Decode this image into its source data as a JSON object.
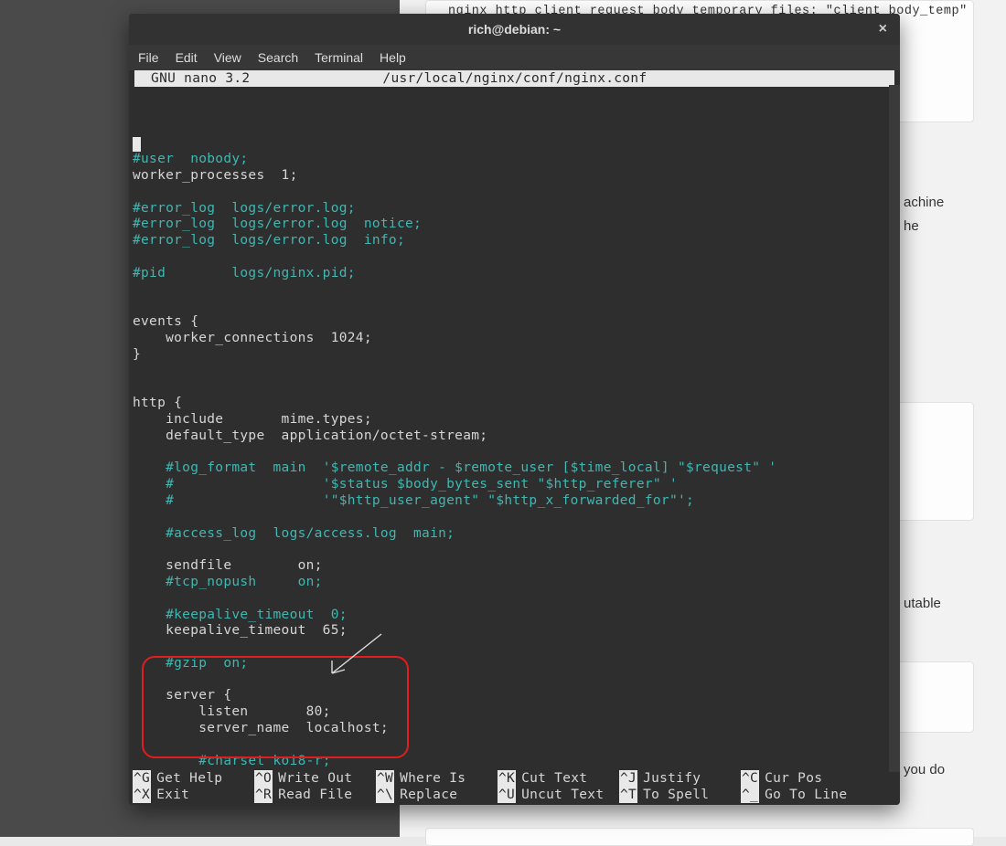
{
  "background": {
    "code_snippet": "nginx http client request body temporary files: \"client_body_temp\"",
    "para1_a": "achine",
    "para1_b": "he",
    "para2": "utable",
    "para3": "you do"
  },
  "terminal": {
    "title": "rich@debian: ~",
    "menu": [
      "File",
      "Edit",
      "View",
      "Search",
      "Terminal",
      "Help"
    ],
    "nano_header_left": "  GNU nano 3.2",
    "nano_header_right": "/usr/local/nginx/conf/nginx.conf",
    "lines": [
      {
        "t": "",
        "c": "plain",
        "cursor": true
      },
      {
        "t": "#user  nobody;",
        "c": "comment"
      },
      {
        "t": "worker_processes  1;",
        "c": "plain"
      },
      {
        "t": "",
        "c": "plain"
      },
      {
        "t": "#error_log  logs/error.log;",
        "c": "comment"
      },
      {
        "t": "#error_log  logs/error.log  notice;",
        "c": "comment"
      },
      {
        "t": "#error_log  logs/error.log  info;",
        "c": "comment"
      },
      {
        "t": "",
        "c": "plain"
      },
      {
        "t": "#pid        logs/nginx.pid;",
        "c": "comment"
      },
      {
        "t": "",
        "c": "plain"
      },
      {
        "t": "",
        "c": "plain"
      },
      {
        "t": "events {",
        "c": "plain"
      },
      {
        "t": "    worker_connections  1024;",
        "c": "plain"
      },
      {
        "t": "}",
        "c": "plain"
      },
      {
        "t": "",
        "c": "plain"
      },
      {
        "t": "",
        "c": "plain"
      },
      {
        "t": "http {",
        "c": "plain"
      },
      {
        "t": "    include       mime.types;",
        "c": "plain"
      },
      {
        "t": "    default_type  application/octet-stream;",
        "c": "plain"
      },
      {
        "t": "",
        "c": "plain"
      },
      {
        "t": "    #log_format  main  '$remote_addr - $remote_user [$time_local] \"$request\" '",
        "c": "comment"
      },
      {
        "t": "    #                  '$status $body_bytes_sent \"$http_referer\" '",
        "c": "comment"
      },
      {
        "t": "    #                  '\"$http_user_agent\" \"$http_x_forwarded_for\"';",
        "c": "comment"
      },
      {
        "t": "",
        "c": "plain"
      },
      {
        "t": "    #access_log  logs/access.log  main;",
        "c": "comment"
      },
      {
        "t": "",
        "c": "plain"
      },
      {
        "t": "    sendfile        on;",
        "c": "plain"
      },
      {
        "t": "    #tcp_nopush     on;",
        "c": "comment"
      },
      {
        "t": "",
        "c": "plain"
      },
      {
        "t": "    #keepalive_timeout  0;",
        "c": "comment"
      },
      {
        "t": "    keepalive_timeout  65;",
        "c": "plain"
      },
      {
        "t": "",
        "c": "plain"
      },
      {
        "t": "    #gzip  on;",
        "c": "comment"
      },
      {
        "t": "",
        "c": "plain"
      },
      {
        "t": "    server {",
        "c": "plain"
      },
      {
        "t": "        listen       80;",
        "c": "plain"
      },
      {
        "t": "        server_name  localhost;",
        "c": "plain"
      },
      {
        "t": "",
        "c": "plain"
      },
      {
        "t": "        #charset koi8-r;",
        "c": "comment"
      },
      {
        "t": "",
        "c": "plain"
      },
      {
        "t": "",
        "c": "plain"
      }
    ],
    "shortcuts_row1": [
      {
        "key": "^G",
        "label": "Get Help"
      },
      {
        "key": "^O",
        "label": "Write Out"
      },
      {
        "key": "^W",
        "label": "Where Is"
      },
      {
        "key": "^K",
        "label": "Cut Text"
      },
      {
        "key": "^J",
        "label": "Justify"
      },
      {
        "key": "^C",
        "label": "Cur Pos"
      }
    ],
    "shortcuts_row2": [
      {
        "key": "^X",
        "label": "Exit"
      },
      {
        "key": "^R",
        "label": "Read File"
      },
      {
        "key": "^\\",
        "label": "Replace"
      },
      {
        "key": "^U",
        "label": "Uncut Text"
      },
      {
        "key": "^T",
        "label": "To Spell"
      },
      {
        "key": "^_",
        "label": "Go To Line"
      }
    ]
  }
}
